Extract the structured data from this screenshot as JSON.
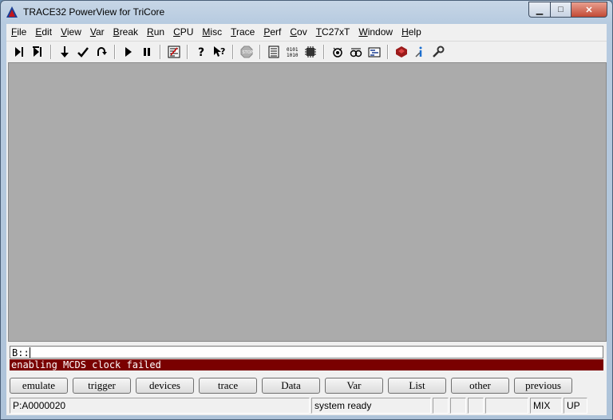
{
  "window": {
    "title": "TRACE32 PowerView for TriCore",
    "controls": {
      "minimize": "▁",
      "maximize": "□",
      "close": "✕"
    }
  },
  "menubar": {
    "items": [
      "File",
      "Edit",
      "View",
      "Var",
      "Break",
      "Run",
      "CPU",
      "Misc",
      "Trace",
      "Perf",
      "Cov",
      "TC27xT",
      "Window",
      "Help"
    ]
  },
  "toolbar": {
    "icons": [
      "step-icon",
      "step-over-icon",
      "step-down-icon",
      "step-return-icon",
      "step-up-icon",
      "go-icon",
      "break-icon",
      "list-source-icon",
      "help-icon",
      "context-help-icon",
      "stop-icon",
      "register-icon",
      "memory-dump-icon",
      "chip-icon",
      "peripheral-icon",
      "trace-view-icon",
      "trace-chart-icon",
      "tricore-icon",
      "tool-info-icon",
      "settings-wrench-icon"
    ]
  },
  "command_line": {
    "prompt": "B::",
    "value": ""
  },
  "message": {
    "text": "enabling MCDS clock failed",
    "color": "#7a0000"
  },
  "softkeys": [
    "emulate",
    "trigger",
    "devices",
    "trace",
    "Data",
    "Var",
    "List",
    "other",
    "previous"
  ],
  "statusbar": {
    "address": "P:A0000020",
    "state": "system ready",
    "mode": "MIX",
    "direction": "UP"
  }
}
